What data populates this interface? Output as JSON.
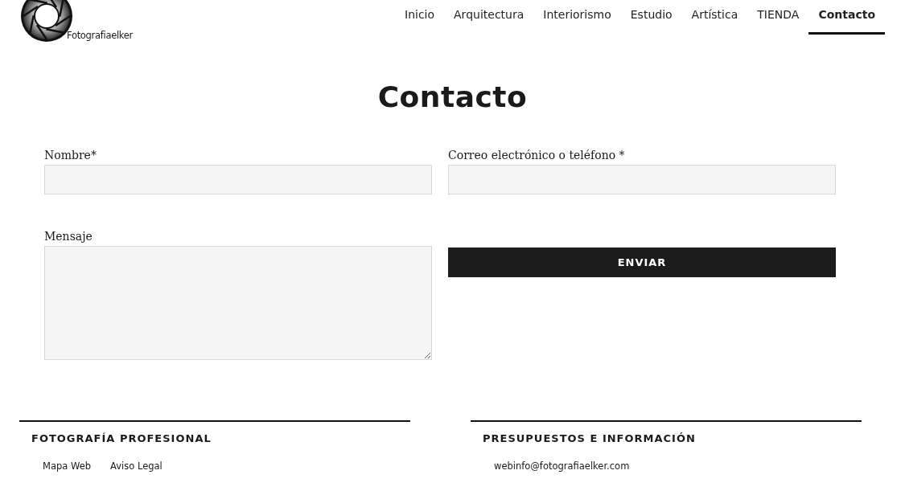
{
  "logo": {
    "text": "Fotografiaelker"
  },
  "nav": [
    {
      "label": "Inicio",
      "selected": false
    },
    {
      "label": "Arquitectura",
      "selected": false
    },
    {
      "label": "Interiorismo",
      "selected": false
    },
    {
      "label": "Estudio",
      "selected": false
    },
    {
      "label": "Artística",
      "selected": false
    },
    {
      "label": "TIENDA",
      "selected": false
    },
    {
      "label": "Contacto",
      "selected": true
    }
  ],
  "page_title": "Contacto",
  "form": {
    "name_label": "Nombre*",
    "contact_label": "Correo electrónico o teléfono *",
    "message_label": "Mensaje",
    "submit": "ENVIAR"
  },
  "footer": [
    {
      "heading": "FOTOGRAFÍA PROFESIONAL",
      "links": [
        "Mapa Web",
        "Aviso Legal"
      ]
    },
    {
      "heading": "PRESUPUESTOS E INFORMACIÓN",
      "links": [
        "webinfo@fotografiaelker.com"
      ]
    }
  ]
}
